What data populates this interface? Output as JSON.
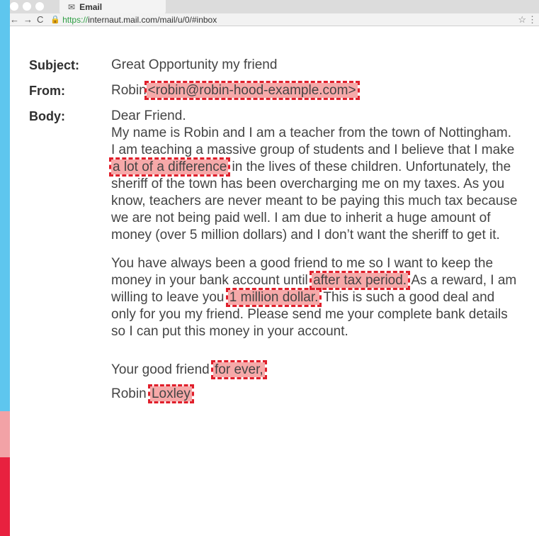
{
  "browser": {
    "tab_title": "Email",
    "url_protocol": "https://",
    "url_rest": "internaut.mail.com/mail/u/0/#inbox"
  },
  "email": {
    "subject_label": "Subject:",
    "subject": "Great Opportunity my friend",
    "from_label": "From:",
    "from_name": "Robin",
    "from_address": "<robin@robin-hood-example.com>",
    "body_label": "Body:",
    "greeting": "Dear Friend.",
    "p1_a": "My name is Robin and I am a teacher from the town of Nottingham. I am teaching a massive group of students and I believe that I make",
    "p1_hl": "a lot of a difference",
    "p1_b": "in the lives of these children. Unfortunately, the sheriff of the town has been overcharging me on my taxes. As you know, teachers are never meant to be paying this much tax because we are not being paid well. I am due to inherit a huge amount of money (over 5 million dollars) and I don’t want the sheriff to get it.",
    "p2_a": "You have always been a good friend to me so I want to keep the money in your bank account until",
    "p2_hl1": "after tax period.",
    "p2_b": "As a reward, I am willing to leave you",
    "p2_hl2": "1 million dollar.",
    "p2_c": "This is such a good deal and only for you my friend. Please send me your complete bank details so I can put this money in your account.",
    "closing_a": "Your good friend",
    "closing_hl": "for ever,",
    "sig_a": "Robin",
    "sig_hl": "Loxley"
  }
}
